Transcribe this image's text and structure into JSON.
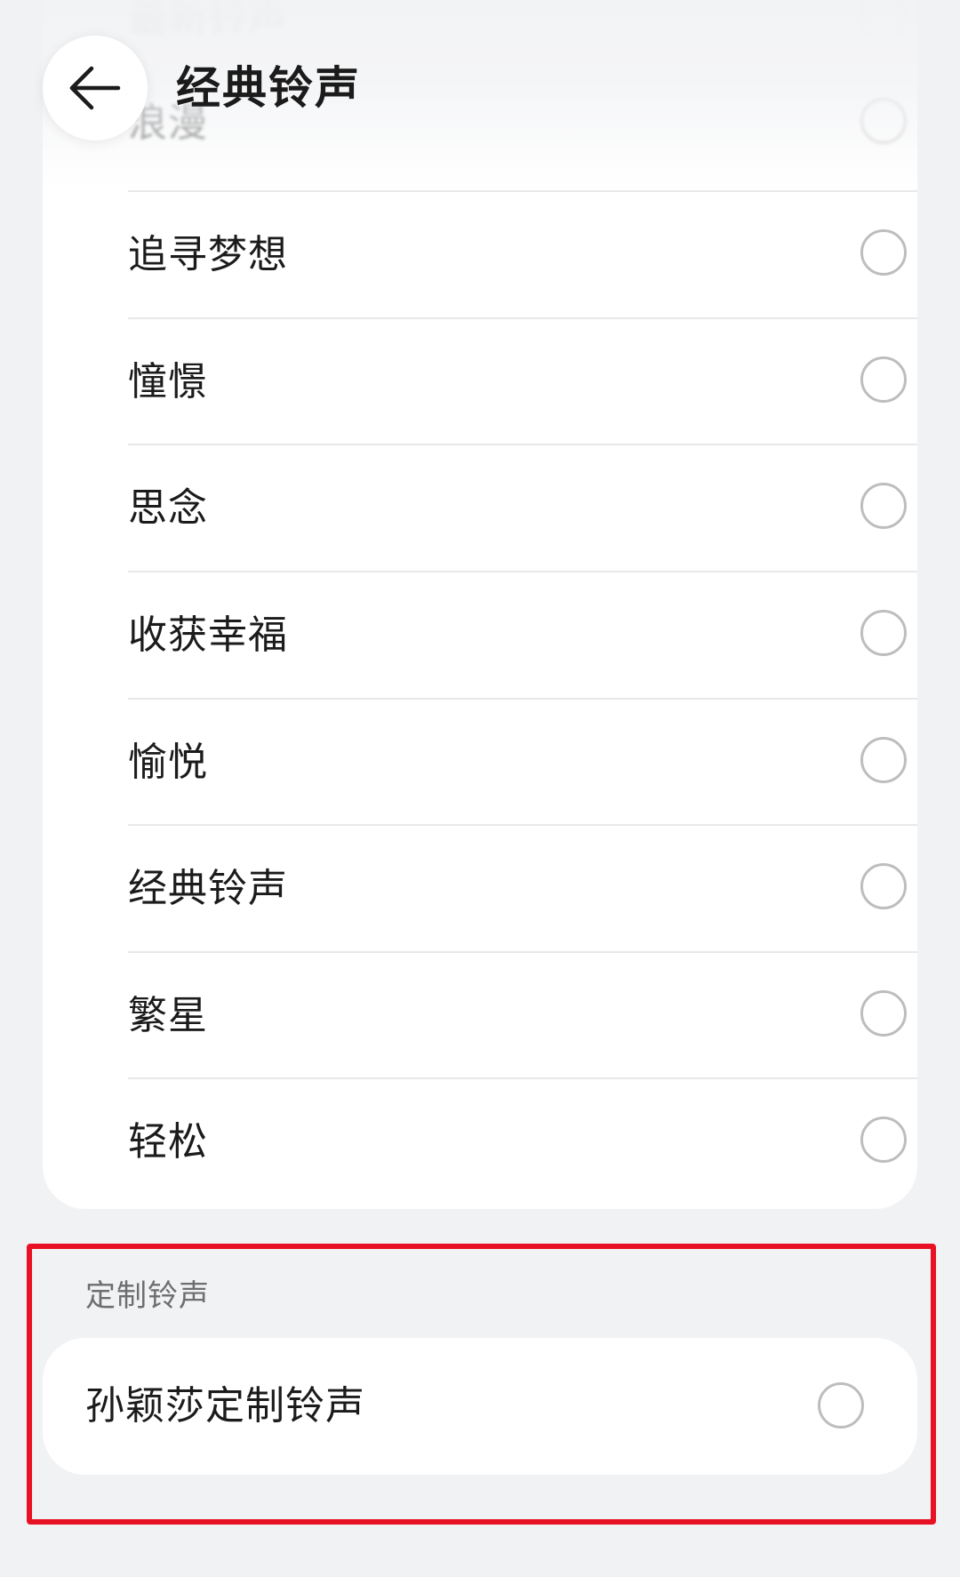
{
  "header": {
    "title": "经典铃声",
    "back_icon": "arrow-left-icon"
  },
  "ringtones": [
    {
      "label": "最新铃声"
    },
    {
      "label": "浪漫"
    },
    {
      "label": "追寻梦想"
    },
    {
      "label": "憧憬"
    },
    {
      "label": "思念"
    },
    {
      "label": "收获幸福"
    },
    {
      "label": "愉悦"
    },
    {
      "label": "经典铃声"
    },
    {
      "label": "繁星"
    },
    {
      "label": "轻松"
    }
  ],
  "custom_section": {
    "header": "定制铃声",
    "items": [
      {
        "label": "孙颖莎定制铃声"
      }
    ]
  },
  "colors": {
    "background": "#f1f2f4",
    "card": "#ffffff",
    "radio_border": "#bdbdbd",
    "highlight": "#e81123"
  }
}
